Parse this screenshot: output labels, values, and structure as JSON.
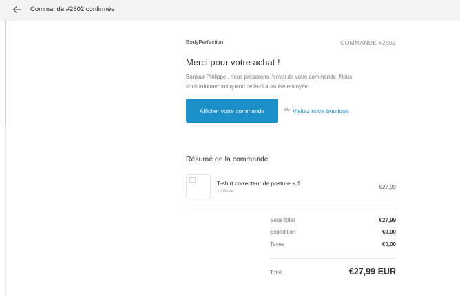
{
  "header": {
    "title": "Commande #2802 confirmée",
    "back_icon": "arrow-left-icon"
  },
  "order": {
    "shop_name": "BodyPerfection",
    "number_label": "COMMANDE #2802",
    "heading": "Merci pour votre achat !",
    "intro_line1": "Bonjour Philippe , nous préparons l'envoi de votre commande. Nous",
    "intro_line2": "vous informerons quand celle-ci aura été envoyée.",
    "view_order_button": "Afficher votre commande",
    "or_text": "ou",
    "shop_link": "Visitez notre boutique",
    "accent_color": "#1b8fc8"
  },
  "summary": {
    "heading": "Résumé de la commande",
    "item": {
      "title": "T-shirt correcteur de posture × 1",
      "variant": "1 / Blanc",
      "price": "€27,99",
      "image_icon": "broken-image-icon"
    },
    "rows": [
      {
        "label": "Sous-total",
        "value": "€27,99"
      },
      {
        "label": "Expédition",
        "value": "€0,00"
      },
      {
        "label": "Taxes",
        "value": "€0,00"
      }
    ],
    "total_label": "Total",
    "total_value": "€27,99 EUR"
  }
}
